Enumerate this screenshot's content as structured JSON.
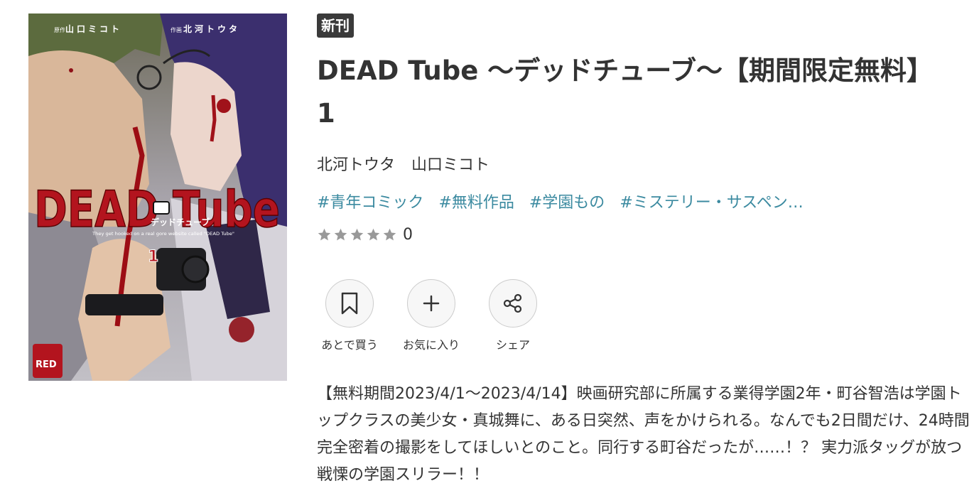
{
  "cover": {
    "credit_left_prefix": "原作",
    "credit_left_name": "山口ミコト",
    "credit_right_prefix": "作画",
    "credit_right_name": "北河トウタ",
    "logo_text": "DEAD Tube",
    "logo_sub": "デッドチューブ",
    "tagline": "They get hooked on a real gore website called \"DEAD Tube\"",
    "volume": "1",
    "imprint": "RED"
  },
  "badge": "新刊",
  "title": "DEAD Tube ～デッドチューブ～【期間限定無料】 1",
  "authors": [
    "北河トウタ",
    "山口ミコト"
  ],
  "tags": [
    "#青年コミック",
    "#無料作品",
    "#学園もの",
    "#ミステリー・サスペン…"
  ],
  "rating": {
    "count": "0",
    "stars_filled": 0,
    "stars_total": 5
  },
  "actions": [
    {
      "label": "あとで買う",
      "icon": "bookmark-icon"
    },
    {
      "label": "お気に入り",
      "icon": "plus-icon"
    },
    {
      "label": "シェア",
      "icon": "share-icon"
    }
  ],
  "description": "【無料期間2023/4/1～2023/4/14】映画研究部に所属する業得学園2年・町谷智浩は学園トップクラスの美少女・真城舞に、ある日突然、声をかけられる。なんでも2日間だけ、24時間完全密着の撮影をしてほしいとのこと。同行する町谷だったが……！？ 実力派タッグが放つ戦慄の学園スリラー！！",
  "colors": {
    "badge_bg": "#3a3a3a",
    "tag": "#3b8aa0",
    "star": "#999999",
    "text": "#333333",
    "logo_red": "#b3141e"
  }
}
